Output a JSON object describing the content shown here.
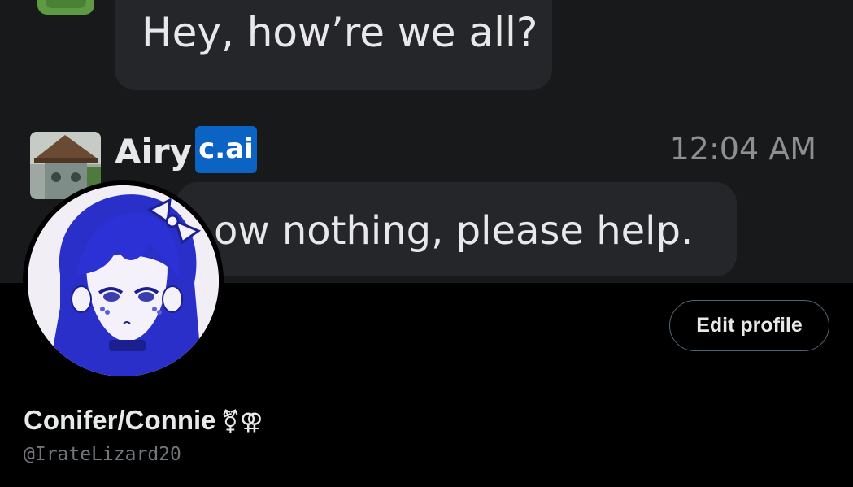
{
  "banner": {
    "message_1": "Hey, how’re we all?",
    "sender": {
      "name": "Airy",
      "badge": "c.ai",
      "time": "12:04 AM"
    },
    "message_2": "ow nothing, please help."
  },
  "profile": {
    "edit_button": "Edit profile",
    "display_name": "Conifer/Connie",
    "name_symbols": "⚧⚢",
    "handle": "@IrateLizard20"
  },
  "colors": {
    "background": "#000000",
    "banner_bg": "#18191b",
    "bubble": "#252629",
    "badge": "#0b63c4",
    "text_primary": "#e7e9ea",
    "text_secondary": "#71767b"
  }
}
